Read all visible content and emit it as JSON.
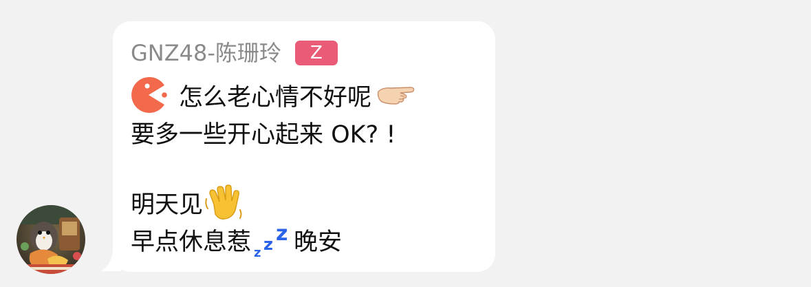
{
  "conversation": {
    "sender": {
      "name": "GNZ48-陈珊玲",
      "badge": "Z"
    },
    "message": {
      "line1": "怎么老心情不好呢",
      "line2": "要多一些开心起来 OK? !",
      "line3": "明天见",
      "line4_before": "早点休息惹",
      "line4_after": "晚安"
    },
    "emojis": [
      "pacman-icon",
      "pointing-hand-icon",
      "waving-hand-icon",
      "zzz-icon"
    ],
    "colors": {
      "background": "#f2f2f2",
      "bubble": "#ffffff",
      "badge": "#ea5b77",
      "sender_name": "#8a8a8a",
      "message_text": "#111111",
      "zzz": "#2a63e8"
    }
  }
}
